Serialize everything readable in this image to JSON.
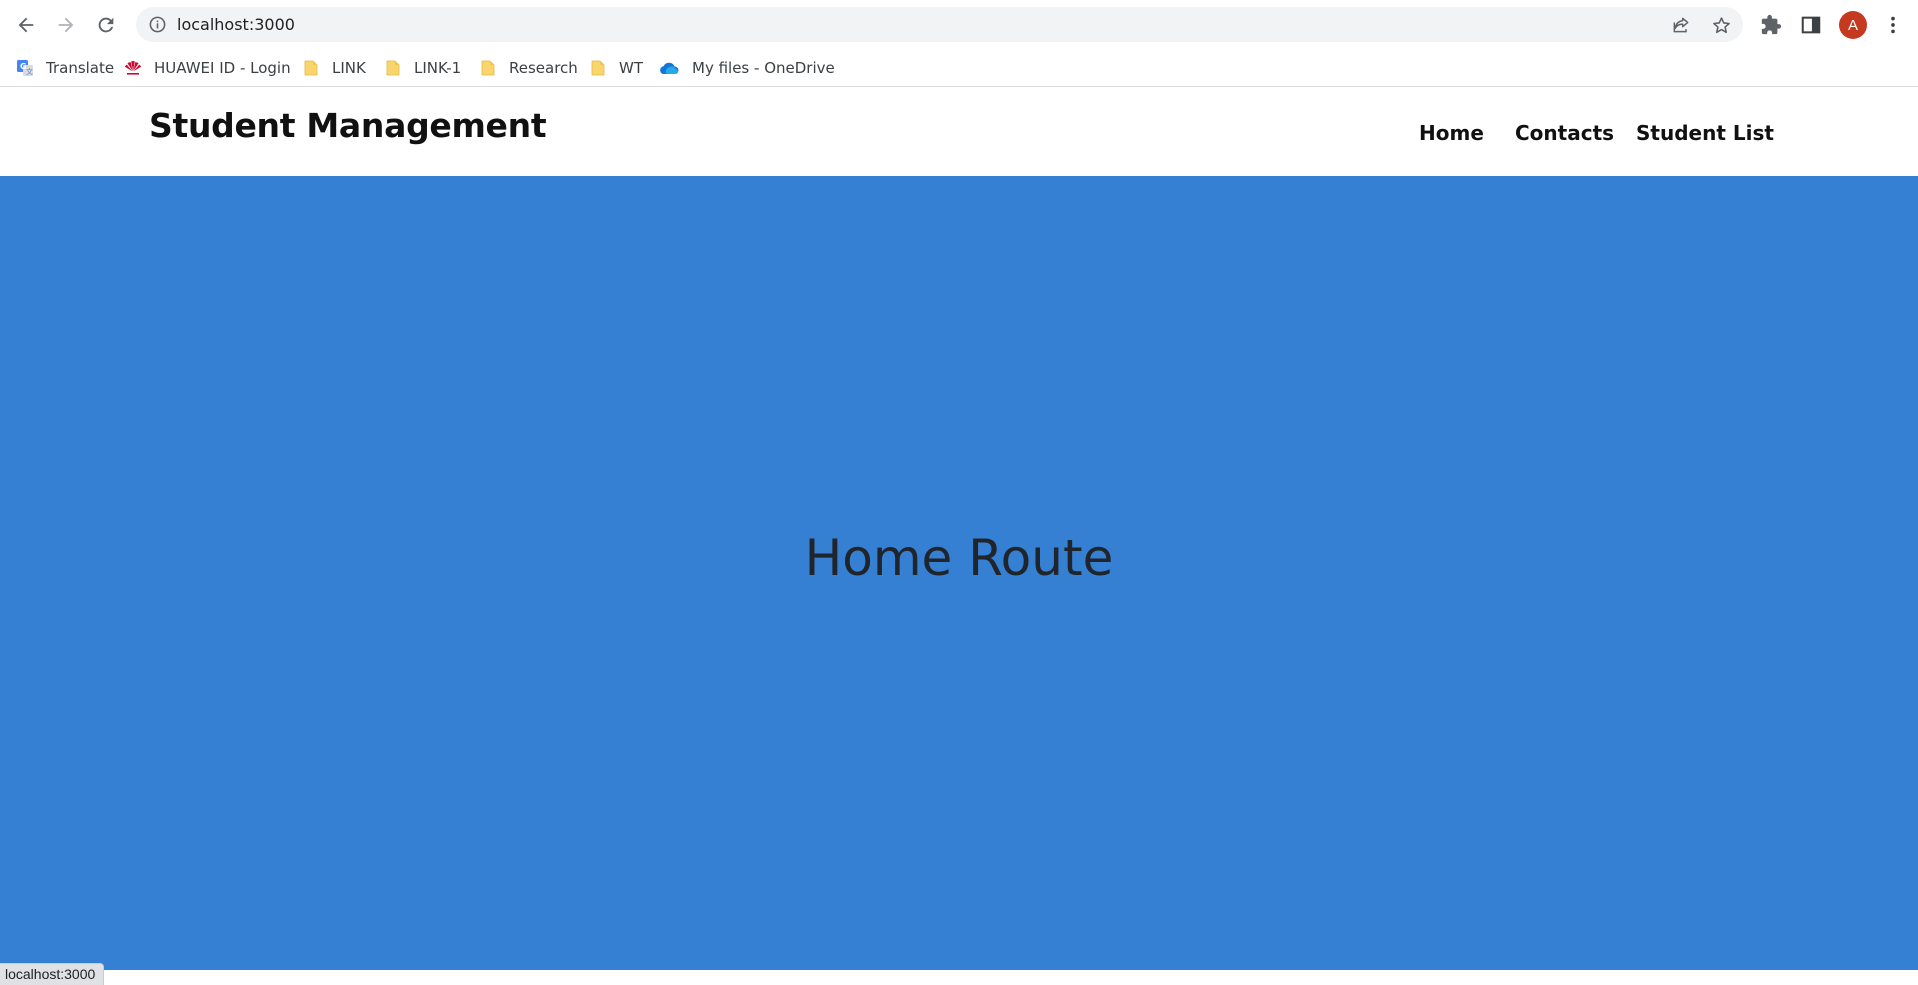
{
  "browser": {
    "url": "localhost:3000",
    "avatar_letter": "A",
    "status_url": "localhost:3000",
    "bookmarks": [
      {
        "label": "Translate",
        "icon": "google-translate-icon"
      },
      {
        "label": "HUAWEI ID - Login",
        "icon": "huawei-icon"
      },
      {
        "label": "LINK",
        "icon": "folder-icon"
      },
      {
        "label": "LINK-1",
        "icon": "folder-icon"
      },
      {
        "label": "Research",
        "icon": "folder-icon"
      },
      {
        "label": "WT",
        "icon": "folder-icon"
      },
      {
        "label": "My files - OneDrive",
        "icon": "onedrive-icon"
      }
    ]
  },
  "site": {
    "brand": "Student Management",
    "nav": [
      {
        "label": "Home"
      },
      {
        "label": "Contacts"
      },
      {
        "label": "Student List"
      }
    ],
    "hero_title": "Home Route"
  },
  "colors": {
    "hero_background": "#3680d3",
    "avatar": "#c5391f",
    "folder": "#f9d56e"
  }
}
